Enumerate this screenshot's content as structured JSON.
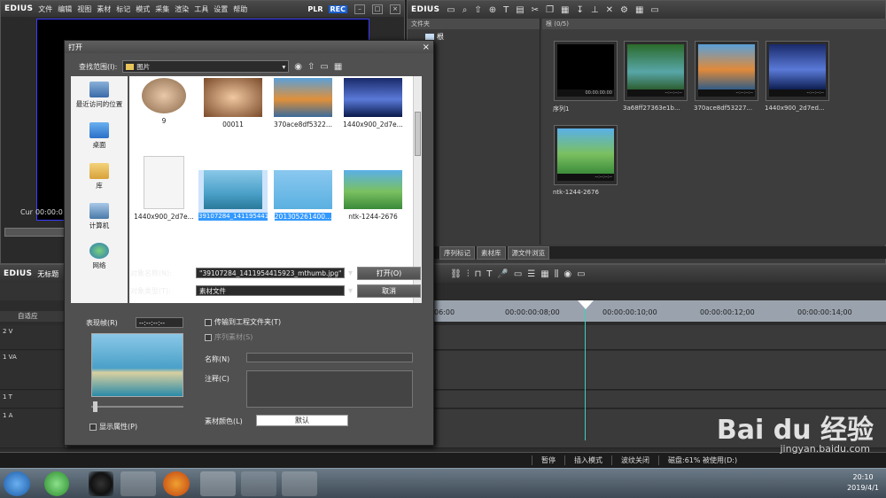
{
  "player": {
    "brand": "EDIUS",
    "menu": [
      "文件",
      "编辑",
      "视图",
      "素材",
      "标记",
      "模式",
      "采集",
      "渲染",
      "工具",
      "设置",
      "帮助"
    ],
    "plr": "PLR",
    "rec": "REC",
    "cur_label": "Cur",
    "cur_time": "00:00:0"
  },
  "bin": {
    "brand": "EDIUS",
    "folder_header": "文件夹",
    "root_label": "根",
    "asset_header": "根 (0/5)",
    "assets": [
      {
        "name": "序列1",
        "timecode": "00:00:00:00"
      },
      {
        "name": "3a68ff27363e1b...",
        "timecode": "--:--:--:--"
      },
      {
        "name": "370ace8df53227...",
        "timecode": "--:--:--:--"
      },
      {
        "name": "1440x900_2d7ed...",
        "timecode": "--:--:--:--"
      },
      {
        "name": "ntk-1244-2676",
        "timecode": "--:--:--:--"
      }
    ],
    "tabs": [
      "序列标记",
      "素材库",
      "源文件浏览"
    ]
  },
  "timeline": {
    "brand": "EDIUS",
    "project": "无标题",
    "auto_label": "自适应",
    "ticks": [
      "06:00",
      "00:00:00:08;00",
      "00:00:00:10;00",
      "00:00:00:12;00",
      "00:00:00:14;00"
    ],
    "tracks": [
      "2 V",
      "1 VA",
      "1 T",
      "1 A"
    ]
  },
  "status": {
    "pause": "暂停",
    "insert_mode": "插入模式",
    "ripple": "波纹关闭",
    "disk": "磁盘:61% 被使用(D:)"
  },
  "dialog": {
    "title": "打开",
    "look_in_label": "查找范围(I):",
    "look_in_value": "图片",
    "places": [
      "最近访问的位置",
      "桌面",
      "库",
      "计算机",
      "网络"
    ],
    "files": [
      {
        "name": "9"
      },
      {
        "name": "00011"
      },
      {
        "name": "370ace8df5322..."
      },
      {
        "name": "1440x900_2d7e..."
      },
      {
        "name": "1440x900_2d7e..."
      },
      {
        "name": "39107284_1411954415923_mthumb"
      },
      {
        "name": "201305261400..."
      },
      {
        "name": "ntk-1244-2676"
      }
    ],
    "filename_label": "对象名称(N):",
    "filename_value": "\"39107284_1411954415923_mthumb.jpg\" \"",
    "filetype_label": "对象类型(T):",
    "filetype_value": "素材文件",
    "open_button": "打开(O)",
    "cancel_button": "取消",
    "preview_label": "表现帧(R)",
    "preview_time": "--:--:--:--",
    "show_props": "显示属性(P)",
    "transfer_project": "传输到工程文件夹(T)",
    "sequence_clip": "序列素材(S)",
    "name_label": "名称(N)",
    "comment_label": "注释(C)",
    "clip_color_label": "素材颜色(L)",
    "clip_color_value": "默认"
  },
  "taskbar": {
    "time": "20:10",
    "date": "2019/4/1"
  },
  "watermark": {
    "main": "Bai du 经验",
    "sub": "jingyan.baidu.com"
  }
}
